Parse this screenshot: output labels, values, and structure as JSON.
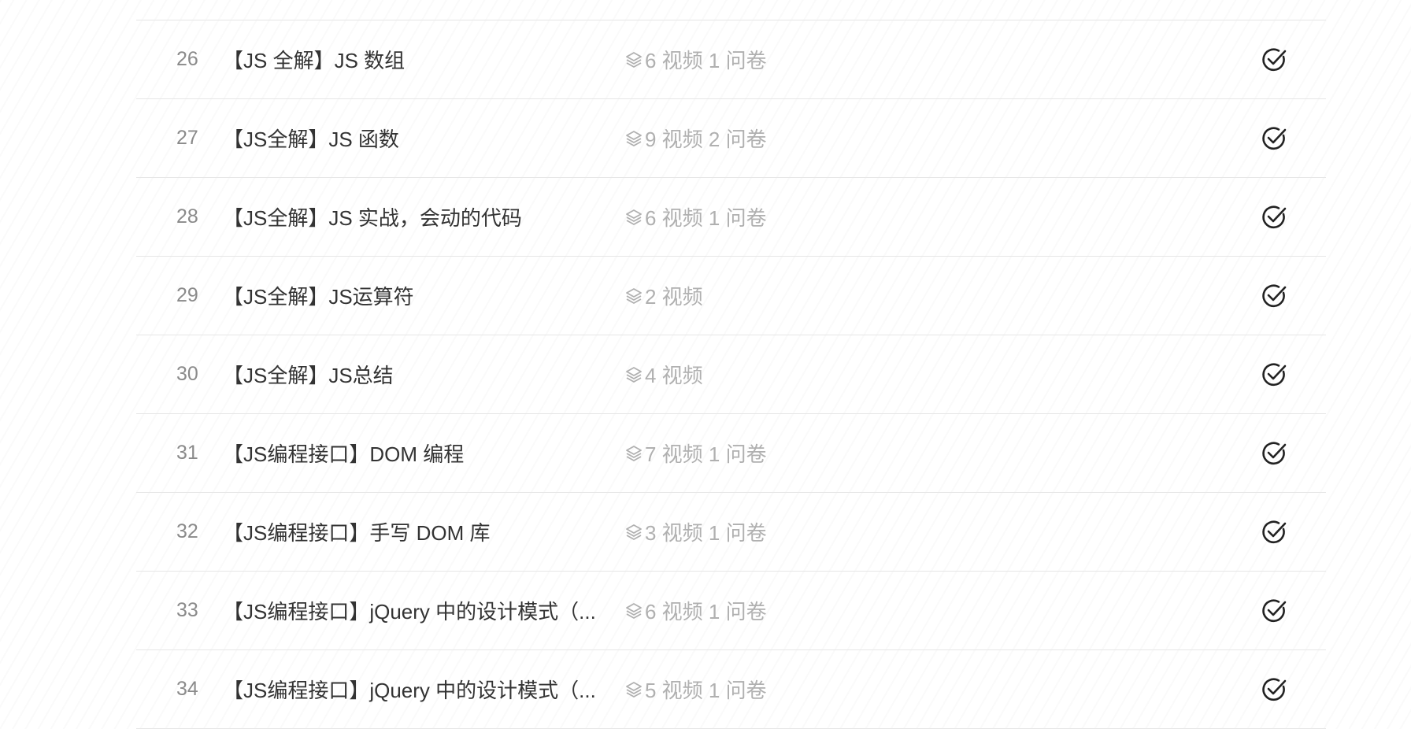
{
  "lessons": [
    {
      "num": "26",
      "title": "【JS 全解】JS 数组",
      "meta": "6 视频 1 问卷"
    },
    {
      "num": "27",
      "title": "【JS全解】JS 函数",
      "meta": "9 视频 2 问卷"
    },
    {
      "num": "28",
      "title": "【JS全解】JS 实战，会动的代码",
      "meta": "6 视频 1 问卷"
    },
    {
      "num": "29",
      "title": "【JS全解】JS运算符",
      "meta": "2 视频"
    },
    {
      "num": "30",
      "title": "【JS全解】JS总结",
      "meta": "4 视频"
    },
    {
      "num": "31",
      "title": "【JS编程接口】DOM 编程",
      "meta": "7 视频 1 问卷"
    },
    {
      "num": "32",
      "title": "【JS编程接口】手写 DOM 库",
      "meta": "3 视频 1 问卷"
    },
    {
      "num": "33",
      "title": "【JS编程接口】jQuery 中的设计模式（...",
      "meta": "6 视频 1 问卷"
    },
    {
      "num": "34",
      "title": "【JS编程接口】jQuery 中的设计模式（...",
      "meta": "5 视频 1 问卷"
    }
  ],
  "icons": {
    "meta": "layers-icon",
    "status": "check-circle-icon"
  },
  "colors": {
    "title": "#333333",
    "number": "#8a8a8a",
    "meta": "#b0b0b0",
    "divider": "#e6e6e6",
    "check": "#222222"
  }
}
